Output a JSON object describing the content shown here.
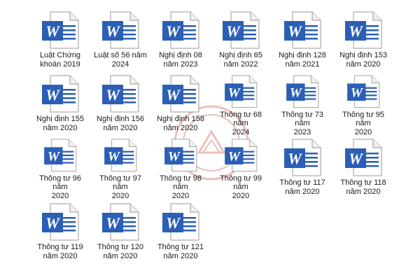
{
  "files": [
    {
      "label": "Luật Chứng\nkhoán 2019",
      "icon": "word-document-icon"
    },
    {
      "label": "Luật số 56 năm\n2024",
      "icon": "word-document-icon"
    },
    {
      "label": "Nghị định 08\nnăm 2023",
      "icon": "word-document-icon"
    },
    {
      "label": "Nghị định 65\nnăm 2022",
      "icon": "word-document-icon"
    },
    {
      "label": "Nghị định 128\nnăm 2021",
      "icon": "word-document-icon"
    },
    {
      "label": "Nghị định 153\nnăm 2020",
      "icon": "word-document-icon"
    },
    {
      "label": "Nghị định 155\nnăm 2020",
      "icon": "word-document-icon"
    },
    {
      "label": "Nghị định 156\nnăm 2020",
      "icon": "word-document-icon"
    },
    {
      "label": "Nghị định 158\nnăm 2020",
      "icon": "word-document-icon"
    },
    {
      "label": "Thông tư 68 năm\n2024",
      "icon": "word-document-icon"
    },
    {
      "label": "Thông tư 73 năm\n2023",
      "icon": "word-document-icon"
    },
    {
      "label": "Thông tư 95 năm\n2020",
      "icon": "word-document-icon"
    },
    {
      "label": "Thông tư 96 năm\n2020",
      "icon": "word-document-icon"
    },
    {
      "label": "Thông tư 97 năm\n2020",
      "icon": "word-document-icon"
    },
    {
      "label": "Thông tư 98 năm\n2020",
      "icon": "word-document-icon"
    },
    {
      "label": "Thông tư 99 năm\n2020",
      "icon": "word-document-icon"
    },
    {
      "label": "Thông tư 117\nnăm 2020",
      "icon": "word-document-icon"
    },
    {
      "label": "Thông tư 118\nnăm 2020",
      "icon": "word-document-icon"
    },
    {
      "label": "Thông tư 119\nnăm 2020",
      "icon": "word-document-icon"
    },
    {
      "label": "Thông tư 120\nnăm 2020",
      "icon": "word-document-icon"
    },
    {
      "label": "Thông tư 121\nnăm 2020",
      "icon": "word-document-icon"
    }
  ],
  "colors": {
    "word_blue": "#2b5eb5",
    "page_bg": "#ffffff",
    "watermark": "#c8372d"
  },
  "watermark": {
    "icon": "seal-watermark-icon"
  }
}
